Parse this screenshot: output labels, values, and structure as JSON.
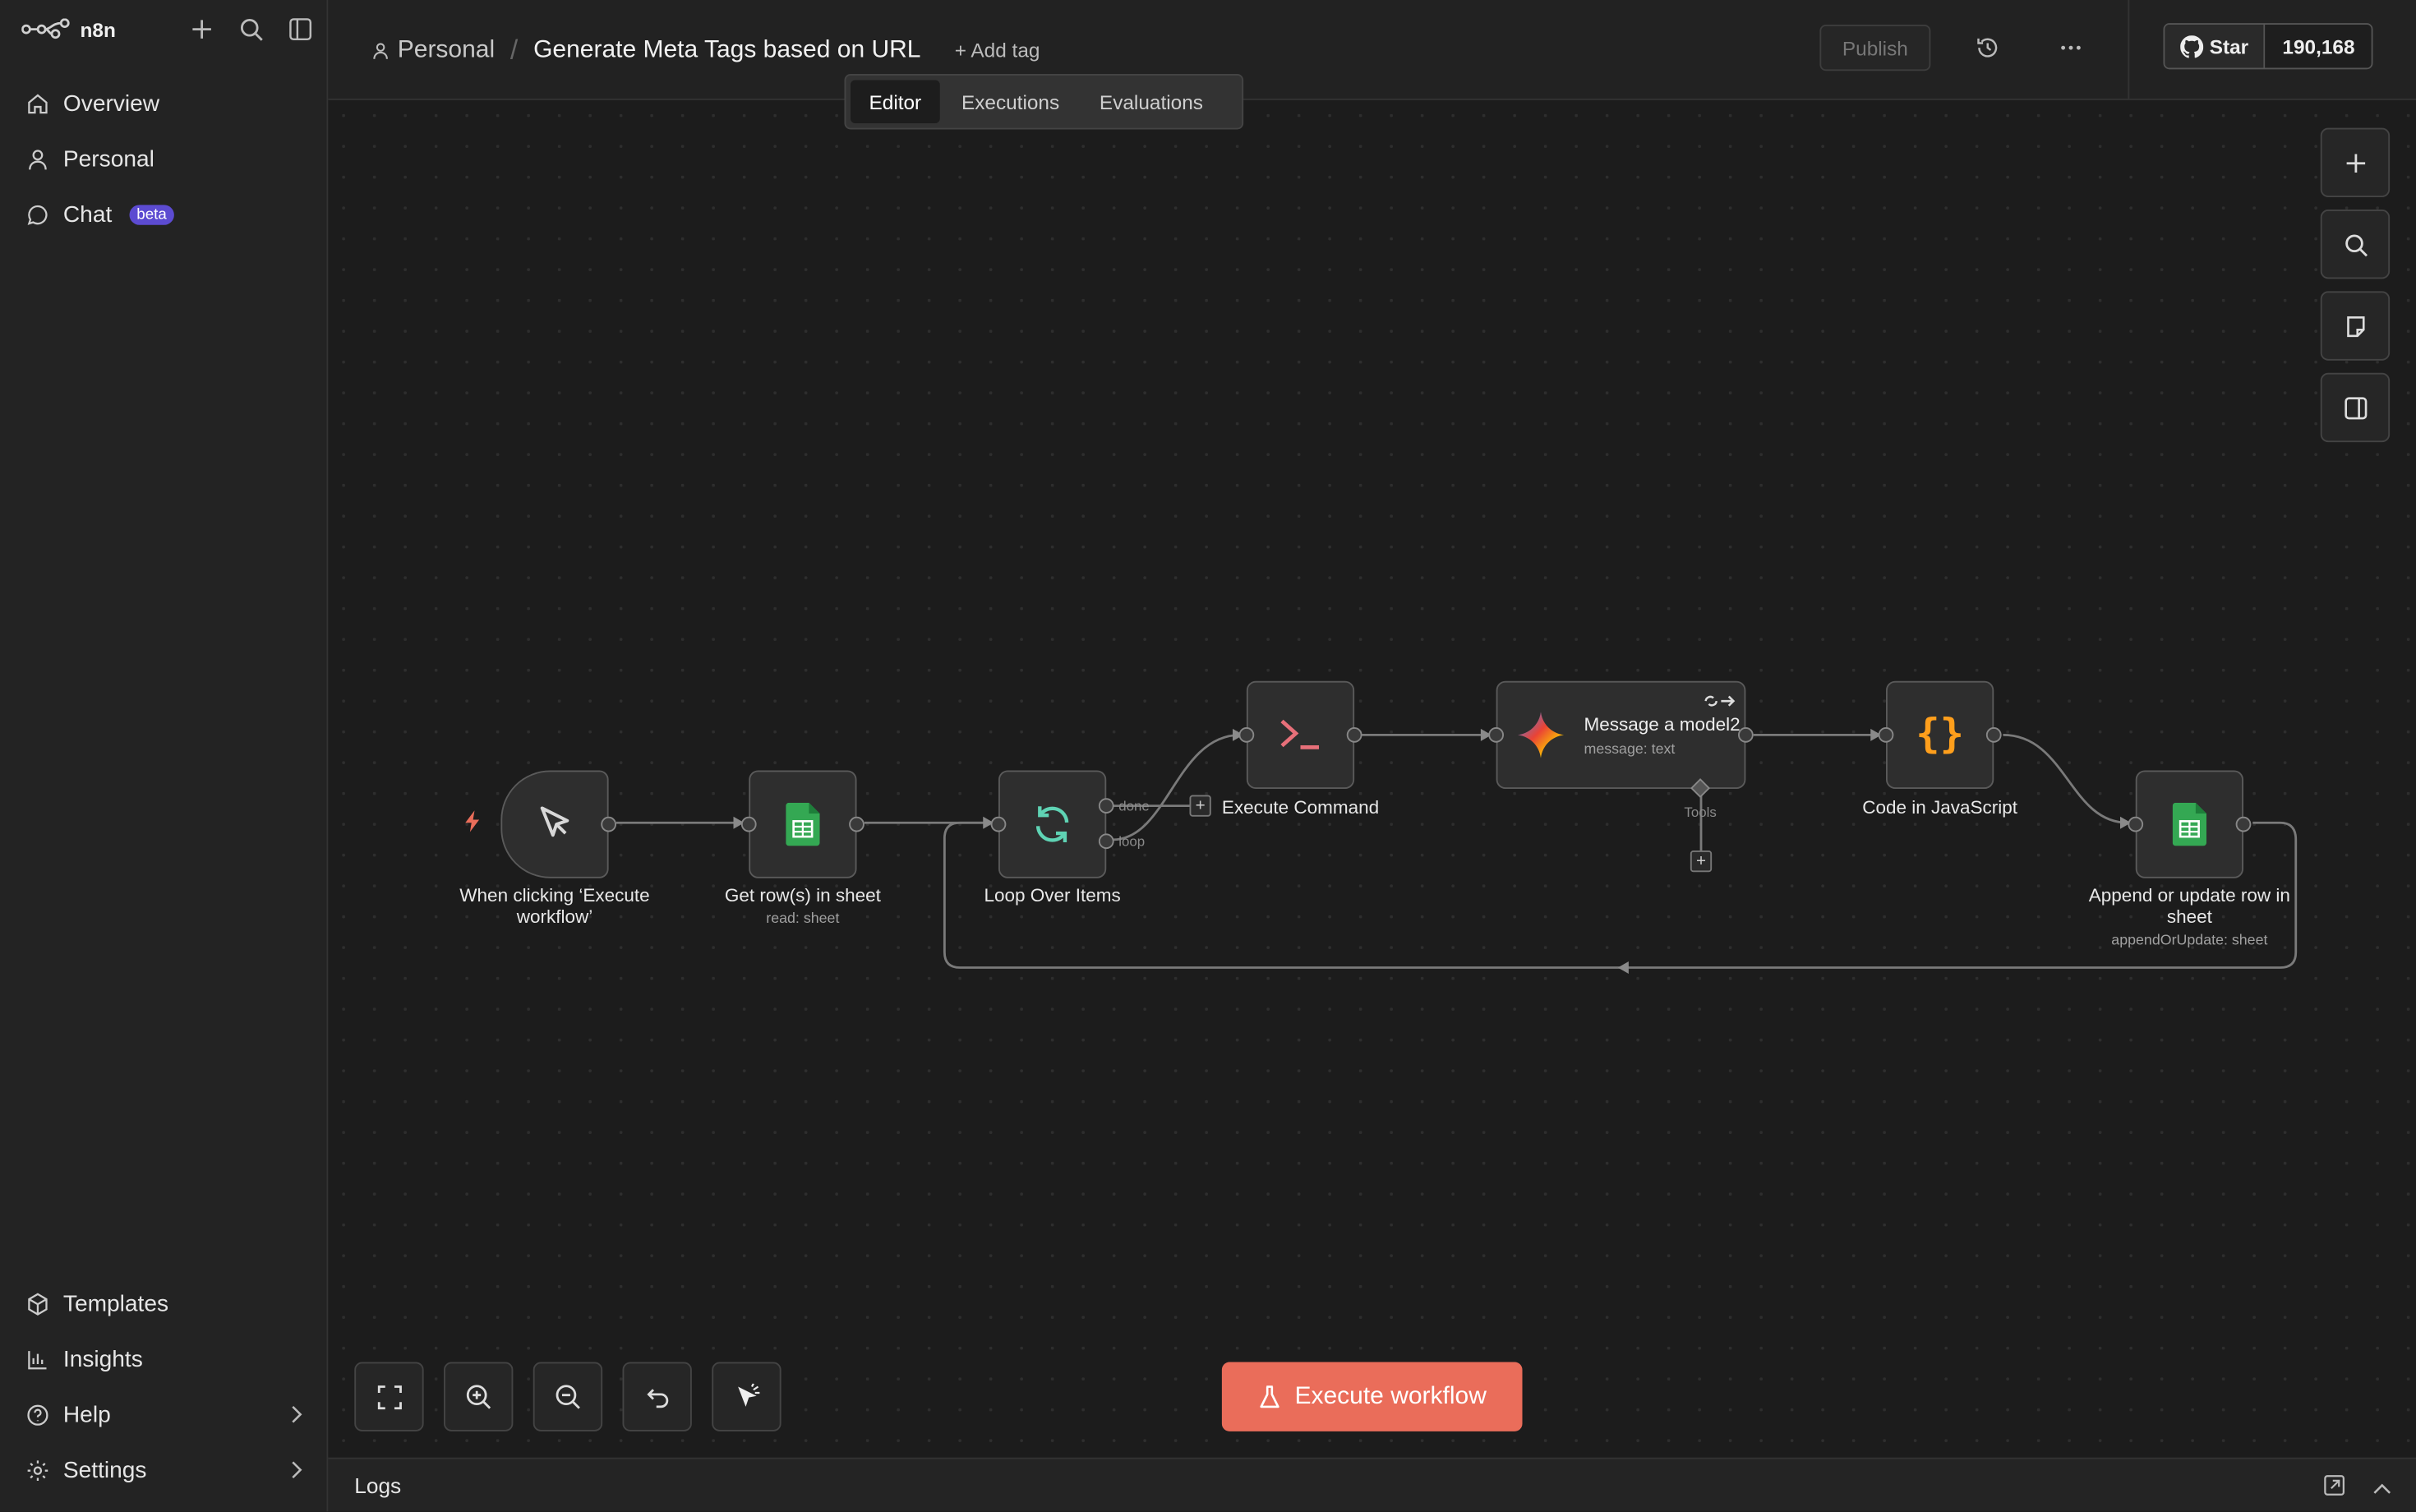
{
  "app": {
    "name": "n8n"
  },
  "sidebar": {
    "items": [
      {
        "label": "Overview",
        "icon": "home-icon"
      },
      {
        "label": "Personal",
        "icon": "user-icon"
      },
      {
        "label": "Chat",
        "icon": "chat-icon",
        "badge": "beta"
      }
    ],
    "bottom_items": [
      {
        "label": "Templates",
        "icon": "templates-icon"
      },
      {
        "label": "Insights",
        "icon": "insights-icon"
      },
      {
        "label": "Help",
        "icon": "help-icon"
      },
      {
        "label": "Settings",
        "icon": "settings-icon"
      }
    ]
  },
  "header": {
    "project": "Personal",
    "workflow_title": "Generate Meta Tags based on URL",
    "add_tag": "+ Add tag",
    "publish": "Publish",
    "github": {
      "star": "Star",
      "count": "190,168"
    }
  },
  "tabs": [
    "Editor",
    "Executions",
    "Evaluations"
  ],
  "active_tab": "Editor",
  "nodes": [
    {
      "id": "trigger",
      "label": "When clicking ‘Execute workflow’",
      "subtitle": ""
    },
    {
      "id": "getrows",
      "label": "Get row(s) in sheet",
      "subtitle": "read: sheet"
    },
    {
      "id": "loop",
      "label": "Loop Over Items",
      "subtitle": "",
      "outputs": [
        "done",
        "loop"
      ]
    },
    {
      "id": "execcmd",
      "label": "Execute Command",
      "subtitle": ""
    },
    {
      "id": "message",
      "label": "Message a model2",
      "subtitle": "message: text",
      "connector": "Tools"
    },
    {
      "id": "code",
      "label": "Code in JavaScript",
      "subtitle": ""
    },
    {
      "id": "append",
      "label": "Append or update row in sheet",
      "subtitle": "appendOrUpdate: sheet"
    }
  ],
  "execute_button": "Execute workflow",
  "logs": {
    "label": "Logs"
  },
  "colors": {
    "accent": "#ea6d5a",
    "sheets": "#34a853",
    "code": "#ff9f1c",
    "loop": "#5fd3b4",
    "terminal": "#e8707a"
  }
}
